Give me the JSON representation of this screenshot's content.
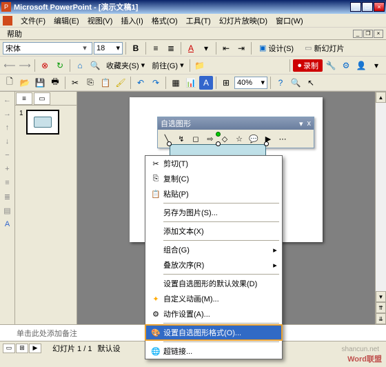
{
  "window": {
    "app": "Microsoft PowerPoint",
    "doc": "[演示文稿1]"
  },
  "menu": {
    "file": "文件(F)",
    "edit": "编辑(E)",
    "view": "视图(V)",
    "insert": "插入(I)",
    "format": "格式(O)",
    "tools": "工具(T)",
    "slideshow": "幻灯片放映(D)",
    "window": "窗口(W)",
    "help": "帮助"
  },
  "format": {
    "font": "宋体",
    "size": "18",
    "bold": "B",
    "ul": "A",
    "design": "设计(S)",
    "newslide": "新幻灯片"
  },
  "toolbar2": {
    "fav": "收藏夹(S)",
    "go": "前往(G)"
  },
  "toolbar3": {
    "rec": "录制",
    "zoom": "40%"
  },
  "outline": {
    "n1": "1"
  },
  "autoshape": {
    "title": "自选图形",
    "close": "x",
    "dd": "▾"
  },
  "context": {
    "cut": "剪切(T)",
    "copy": "复制(C)",
    "paste": "粘贴(P)",
    "savepic": "另存为图片(S)...",
    "addtext": "添加文本(X)",
    "group": "组合(G)",
    "order": "叠放次序(R)",
    "defaults": "设置自选图形的默认效果(D)",
    "anim": "自定义动画(M)...",
    "action": "动作设置(A)...",
    "fmtshape": "设置自选图形格式(O)...",
    "hyperlink": "超链接..."
  },
  "notes": "单击此处添加备注",
  "status": {
    "slide": "幻灯片 1 / 1",
    "design": "默认设"
  },
  "watermark": "Word联盟",
  "watermark2": "shancun.net"
}
